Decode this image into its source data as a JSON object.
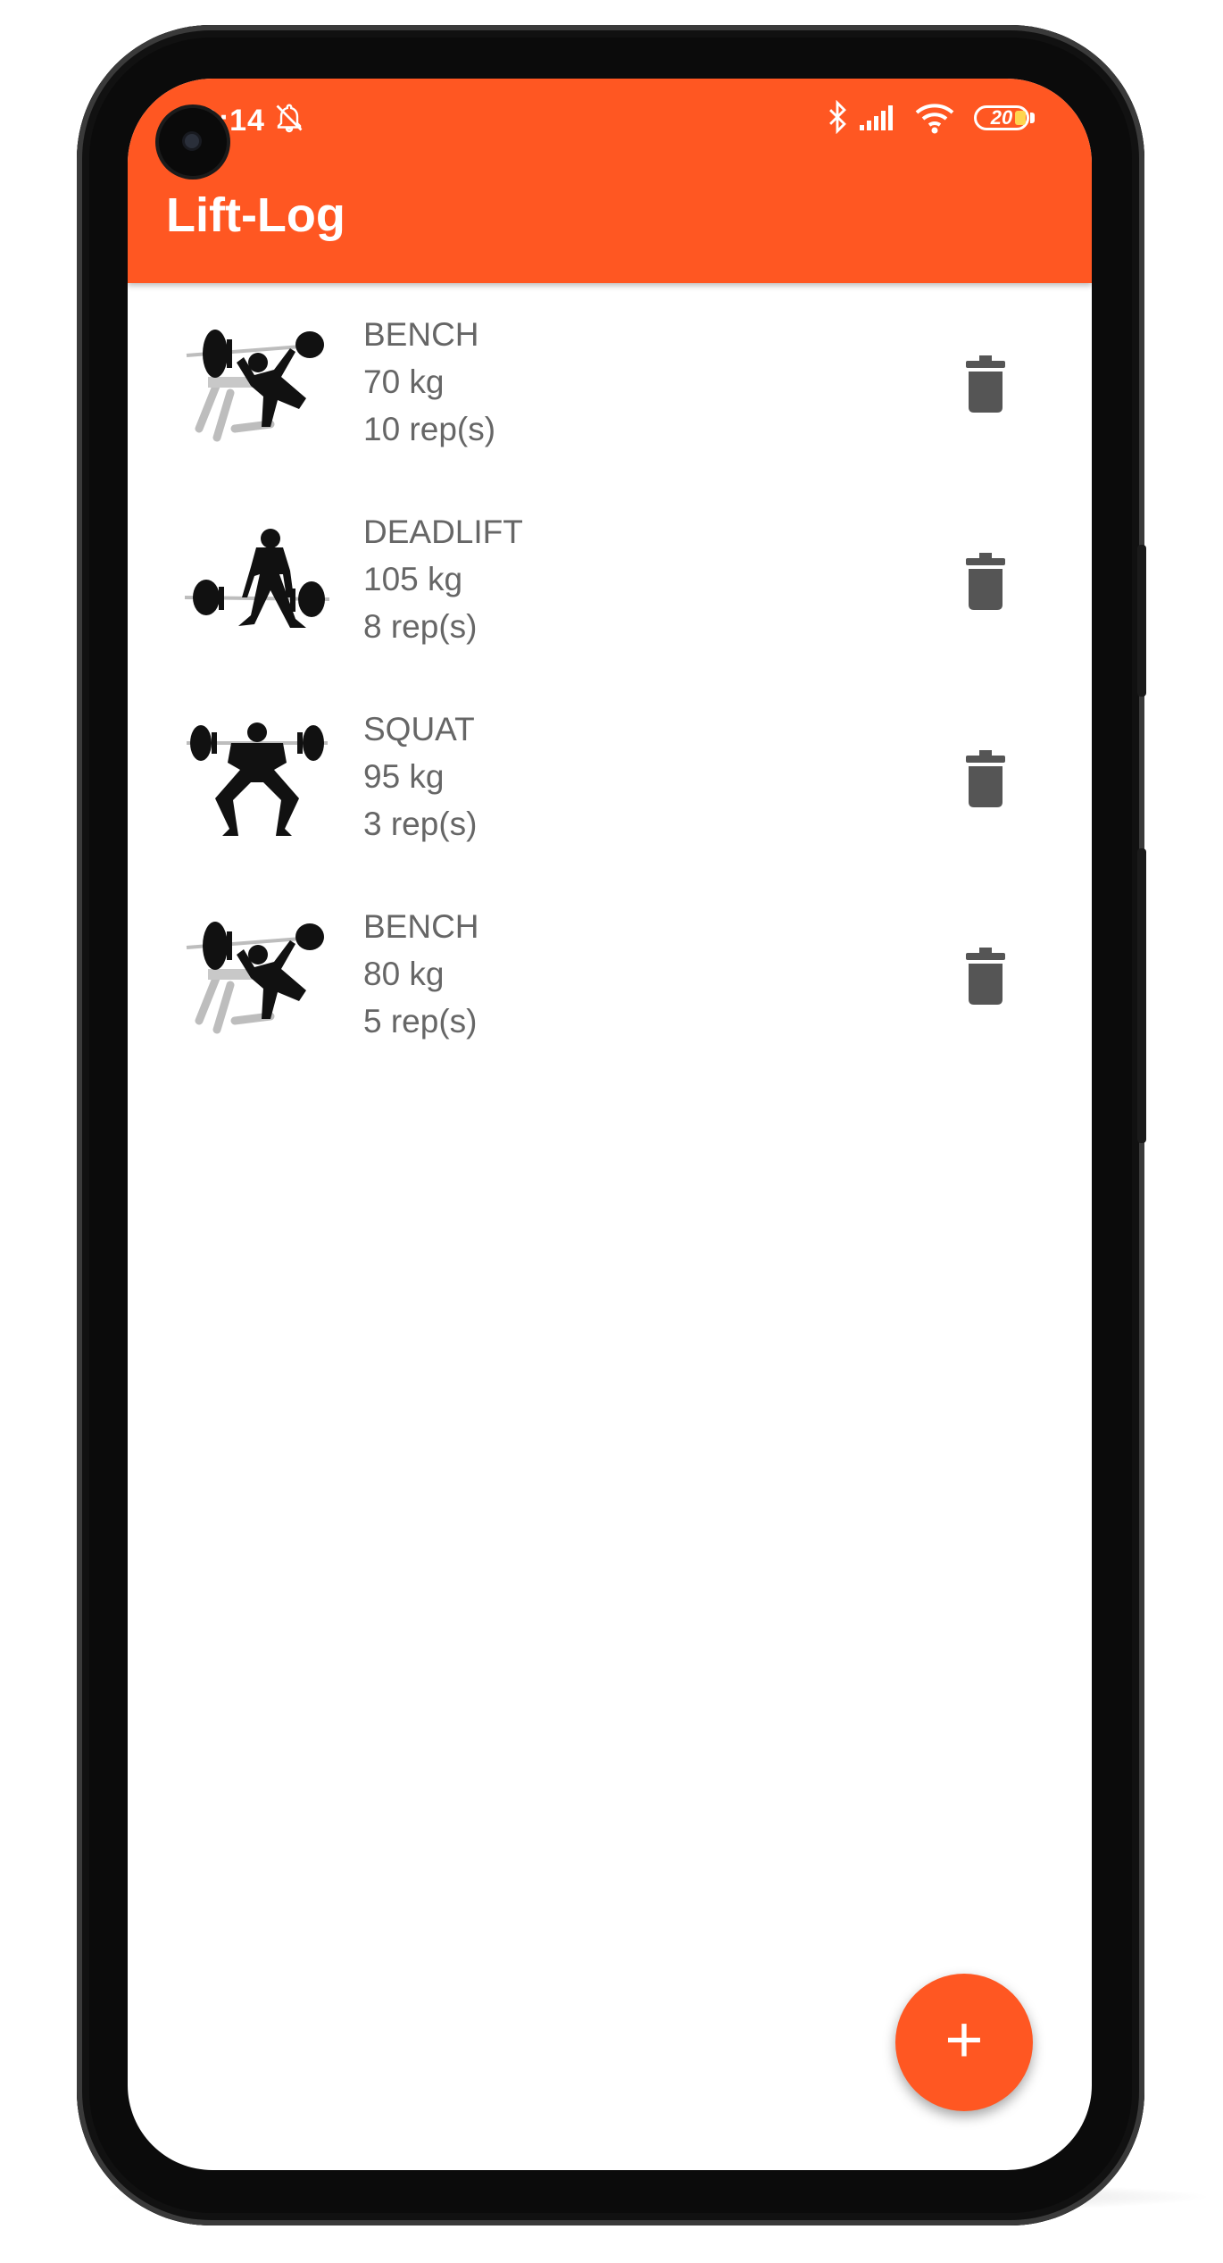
{
  "status_bar": {
    "time": "20:14",
    "icons": [
      "bell-off-icon",
      "bluetooth-icon",
      "signal-icon",
      "wifi-icon"
    ],
    "battery_level": "20"
  },
  "app_bar": {
    "title": "Lift-Log"
  },
  "lifts": [
    {
      "exercise": "BENCH",
      "weight": "70 kg",
      "reps": "10 rep(s)",
      "icon": "bench-press-figure"
    },
    {
      "exercise": "DEADLIFT",
      "weight": "105 kg",
      "reps": "8 rep(s)",
      "icon": "deadlift-figure"
    },
    {
      "exercise": "SQUAT",
      "weight": "95 kg",
      "reps": "3 rep(s)",
      "icon": "squat-figure"
    },
    {
      "exercise": "BENCH",
      "weight": "80 kg",
      "reps": "5 rep(s)",
      "icon": "bench-press-figure"
    }
  ],
  "fab": {
    "glyph": "+",
    "icon": "add-icon"
  },
  "colors": {
    "accent": "#ff5722",
    "text": "#666666",
    "icon": "#555555",
    "frame": "#0b0b0b"
  }
}
